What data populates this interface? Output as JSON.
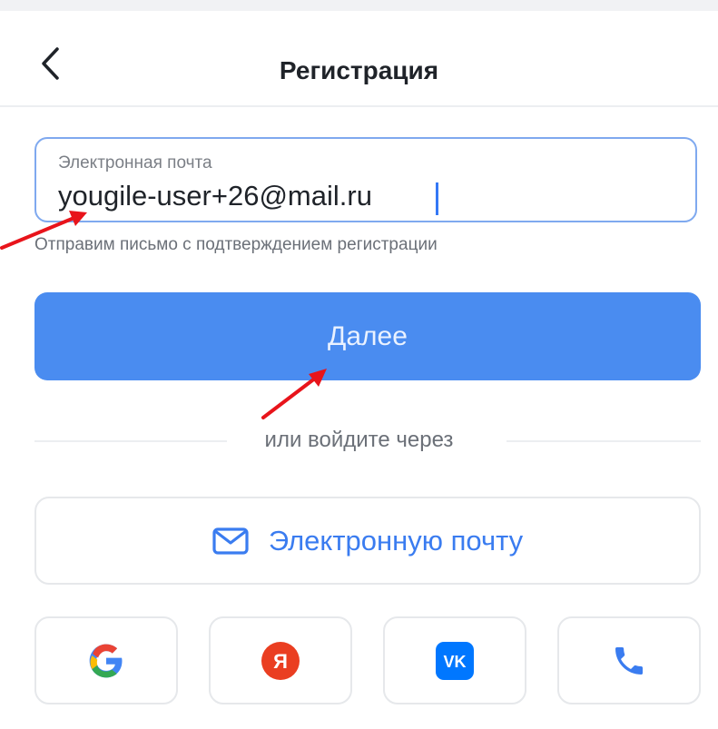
{
  "header": {
    "title": "Регистрация",
    "back_icon": "chevron-left-icon"
  },
  "form": {
    "email": {
      "label": "Электронная почта",
      "value": "yougile-user+26@mail.ru"
    },
    "hint": "Отправим письмо с подтверждением регистрации",
    "submit_label": "Далее"
  },
  "alt_login": {
    "separator": "или войдите через",
    "email_button": {
      "label": "Электронную почту",
      "icon": "mail-icon"
    },
    "providers": [
      {
        "icon": "google-icon"
      },
      {
        "icon": "yandex-icon",
        "glyph": "Я"
      },
      {
        "icon": "vk-icon",
        "glyph": "VK"
      },
      {
        "icon": "phone-icon"
      }
    ]
  },
  "colors": {
    "accent": "#4a8cf0",
    "link": "#3a7cf0",
    "annotation_arrow": "#e8141b",
    "yandex": "#ea3e21",
    "vk": "#0077ff"
  }
}
